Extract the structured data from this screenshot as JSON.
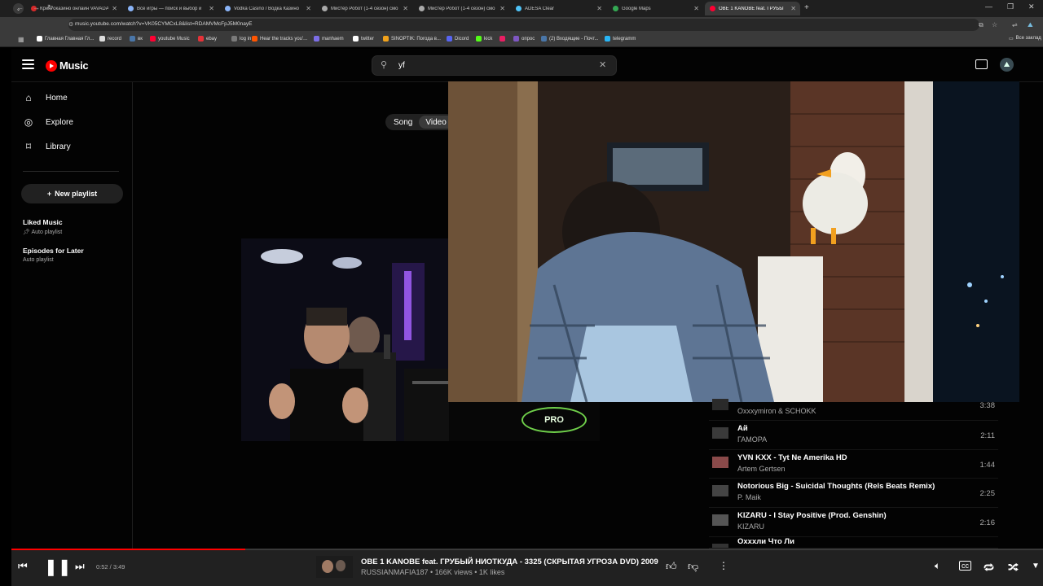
{
  "browser": {
    "tabs": [
      {
        "title": "Криптоказино онлайн VAVADA",
        "color": "#d62a2a"
      },
      {
        "title": "Все игры — поиск и выбор и",
        "color": "#8ab4f8"
      },
      {
        "title": "Vodka Casino / Водка Казино",
        "color": "#8ab4f8"
      },
      {
        "title": "Мистер Робот (1-4 сезон) смо",
        "color": "#aaaaaa"
      },
      {
        "title": "Мистер Робот (1-4 сезон) смо",
        "color": "#aaaaaa"
      },
      {
        "title": "ADESA Clear",
        "color": "#4fc3f7"
      },
      {
        "title": "Google Maps",
        "color": "#34a853"
      },
      {
        "title": "OBE 1 KANOBE feat. ГРУБЫ",
        "color": "#ff0033"
      }
    ],
    "active_tab": 7,
    "url": "music.youtube.com/watch?v=VK05CYMCxL8&list=RDAMVMcFpJ5M0nayE",
    "bookmarks": [
      {
        "label": "Главная Главная Гл...",
        "color": "#ffffff"
      },
      {
        "label": "record",
        "color": "#dddddd"
      },
      {
        "label": "вк",
        "color": "#4a76a8"
      },
      {
        "label": "youtube Music",
        "color": "#ff0033"
      },
      {
        "label": "ebay",
        "color": "#e53238"
      },
      {
        "label": "log in",
        "color": "#7a7a7a"
      },
      {
        "label": "Hear the tracks you'...",
        "color": "#ff5500"
      },
      {
        "label": "manhaem",
        "color": "#7c6ee6"
      },
      {
        "label": "twitter",
        "color": "#ffffff"
      },
      {
        "label": "SINOPTIK: Погода в...",
        "color": "#f1a21b"
      },
      {
        "label": "Dicord",
        "color": "#5865f2"
      },
      {
        "label": "kick",
        "color": "#53fc18"
      },
      {
        "label": "",
        "color": "#e91e63"
      },
      {
        "label": "опрос",
        "color": "#7e57c2"
      },
      {
        "label": "(2) Входящие - Почт...",
        "color": "#4a76a8"
      },
      {
        "label": "telegramm",
        "color": "#29b6f6"
      }
    ],
    "all_bookmarks_label": "Все заклад"
  },
  "header": {
    "logo_text": "Music",
    "search_value": "yf"
  },
  "sidebar": {
    "items": [
      {
        "label": "Home",
        "icon": "home-icon"
      },
      {
        "label": "Explore",
        "icon": "compass-icon"
      },
      {
        "label": "Library",
        "icon": "bookmark-icon"
      }
    ],
    "new_playlist_label": "New playlist",
    "playlists": [
      {
        "title": "Liked Music",
        "subtitle": "Auto playlist",
        "pinned": true
      },
      {
        "title": "Episodes for Later",
        "subtitle": "Auto playlist",
        "pinned": false
      }
    ]
  },
  "toggle": {
    "options": [
      "Song",
      "Video"
    ],
    "selected": "Video"
  },
  "video_overlay_text": "PRO",
  "queue": [
    {
      "title": "",
      "artist": "Oxxxymiron & SCHOKK",
      "duration": "3:38"
    },
    {
      "title": "Ай",
      "artist": "ГАМОРА",
      "duration": "2:11"
    },
    {
      "title": "YVN KXX - Tyt Ne Amerika HD",
      "artist": "Artem Gertsen",
      "duration": "1:44"
    },
    {
      "title": "Notorious Big - Suicidal Thoughts (Rels Beats Remix)",
      "artist": "P. Maik",
      "duration": "2:25"
    },
    {
      "title": "KIZARU - I Stay Positive (Prod. Genshin)",
      "artist": "KIZARU",
      "duration": "2:16"
    },
    {
      "title": "Охххли Что Ли",
      "artist": "",
      "duration": ""
    }
  ],
  "player": {
    "time": "0:52 / 3:49",
    "progress_fraction": 0.227,
    "title": "OBE 1 KANOBE feat. ГРУБЫЙ НИОТКУДА - 3325 (СКРЫТАЯ УГРОЗА DVD) 2009",
    "subtitle": "RUSSIANMAFIA187 • 166K views • 1K likes"
  }
}
